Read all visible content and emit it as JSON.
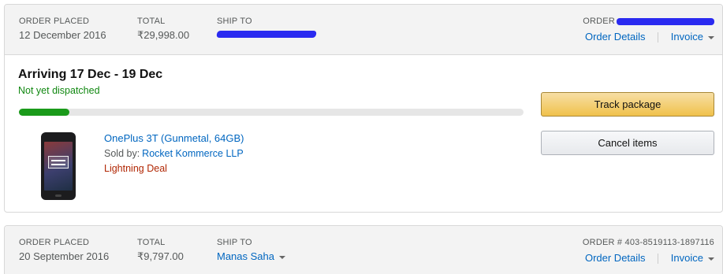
{
  "orders": [
    {
      "header": {
        "placed_label": "ORDER PLACED",
        "placed_value": "12 December 2016",
        "total_label": "TOTAL",
        "total_value": "₹29,998.00",
        "ship_label": "SHIP TO",
        "order_label": "ORDER",
        "details_link": "Order Details",
        "invoice_link": "Invoice"
      },
      "shipment": {
        "arrival": "Arriving 17 Dec - 19 Dec",
        "status": "Not yet dispatched",
        "progress": 0.1,
        "progress_color": "#1a9a1a"
      },
      "item": {
        "name": "OnePlus 3T (Gunmetal, 64GB)",
        "sold_by_label": "Sold by:",
        "seller": "Rocket Kommerce LLP",
        "deal": "Lightning Deal",
        "image_icon": "phone-icon"
      },
      "actions": {
        "track": "Track package",
        "cancel": "Cancel items"
      }
    },
    {
      "header": {
        "placed_label": "ORDER PLACED",
        "placed_value": "20 September 2016",
        "total_label": "TOTAL",
        "total_value": "₹9,797.00",
        "ship_label": "SHIP TO",
        "ship_value": "Manas Saha",
        "order_label": "ORDER #",
        "order_value": "403-8519113-1897116",
        "details_link": "Order Details",
        "invoice_link": "Invoice"
      }
    }
  ],
  "colors": {
    "link": "#0066c0",
    "status_green": "#118811",
    "deal_red": "#b12704",
    "redaction": "#2a2af0"
  }
}
